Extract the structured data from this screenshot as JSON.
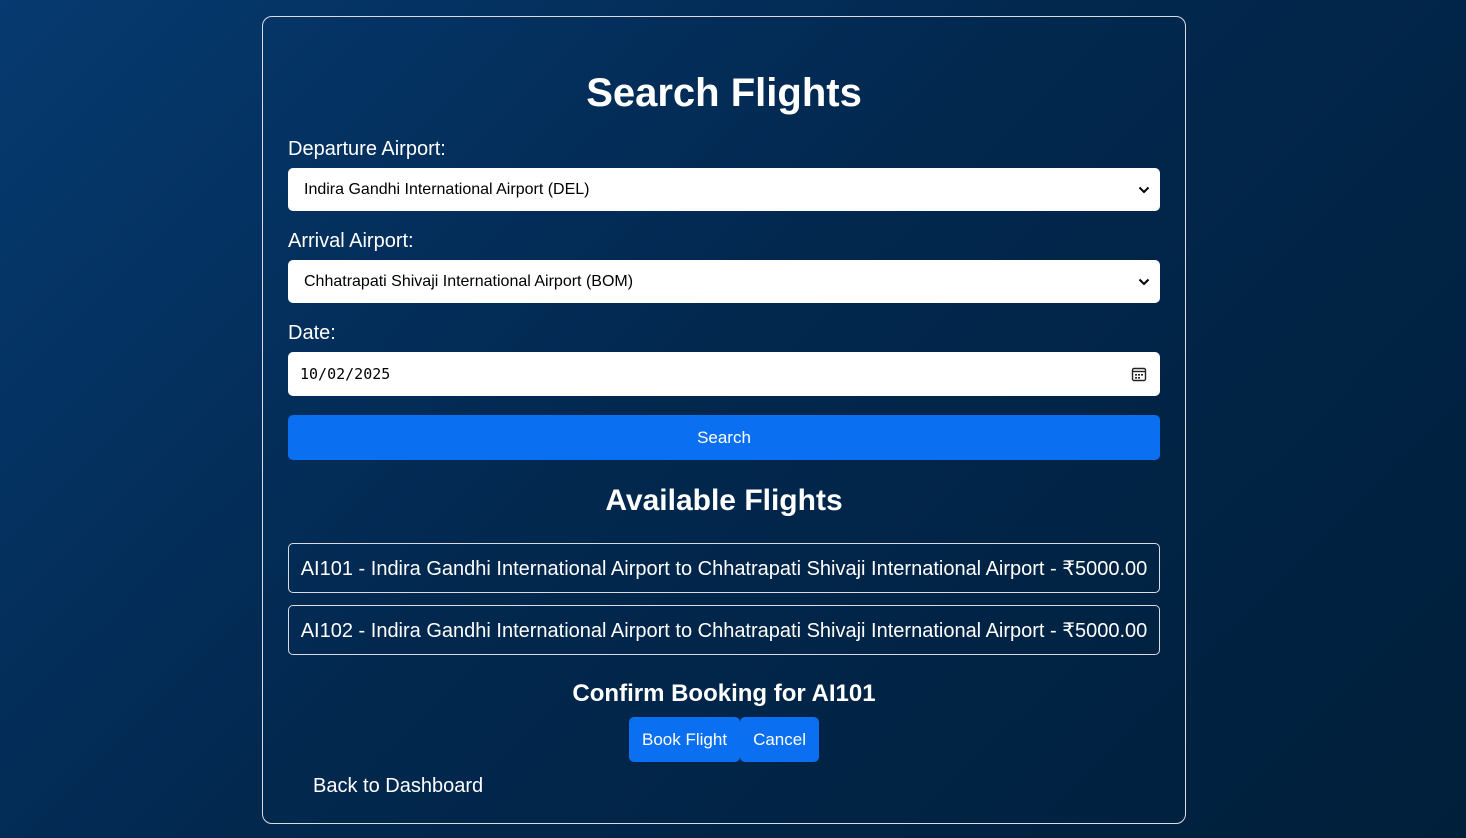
{
  "form": {
    "title": "Search Flights",
    "departure_label": "Departure Airport:",
    "departure_value": "Indira Gandhi International Airport (DEL)",
    "arrival_label": "Arrival Airport:",
    "arrival_value": "Chhatrapati Shivaji International Airport (BOM)",
    "date_label": "Date:",
    "date_value": "10/02/2025",
    "search_label": "Search"
  },
  "results": {
    "title": "Available Flights",
    "flights": [
      {
        "label": "AI101 - Indira Gandhi International Airport to Chhatrapati Shivaji International Airport - ₹5000.00"
      },
      {
        "label": "AI102 - Indira Gandhi International Airport to Chhatrapati Shivaji International Airport - ₹5000.00"
      }
    ]
  },
  "booking": {
    "title": "Confirm Booking for AI101",
    "book_label": "Book Flight",
    "cancel_label": "Cancel"
  },
  "nav": {
    "back_label": "Back to Dashboard"
  },
  "icons": {
    "select_arrow": "chevron-down-icon",
    "date_picker": "calendar-icon"
  },
  "colors": {
    "background": "#02284f",
    "accent": "#0a6ff0",
    "card_border": "#d9dde3"
  }
}
